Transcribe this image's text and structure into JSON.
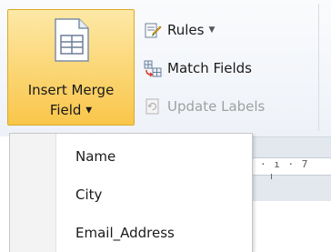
{
  "ribbon": {
    "insert_merge_field": {
      "line1": "Insert Merge",
      "line2": "Field",
      "icon": "document-table-icon"
    },
    "rules": {
      "label": "Rules",
      "icon": "rules-icon"
    },
    "match_fields": {
      "label": "Match Fields",
      "icon": "match-fields-icon"
    },
    "update_labels": {
      "label": "Update Labels",
      "icon": "update-labels-icon",
      "enabled": false
    }
  },
  "ruler": {
    "marks": "· ı · 7"
  },
  "dropdown": {
    "items": [
      {
        "label": "Name"
      },
      {
        "label": "City"
      },
      {
        "label": "Email_Address"
      }
    ]
  },
  "colors": {
    "button_highlight": "#f9c64a",
    "ribbon_bg": "#eef2f8"
  }
}
